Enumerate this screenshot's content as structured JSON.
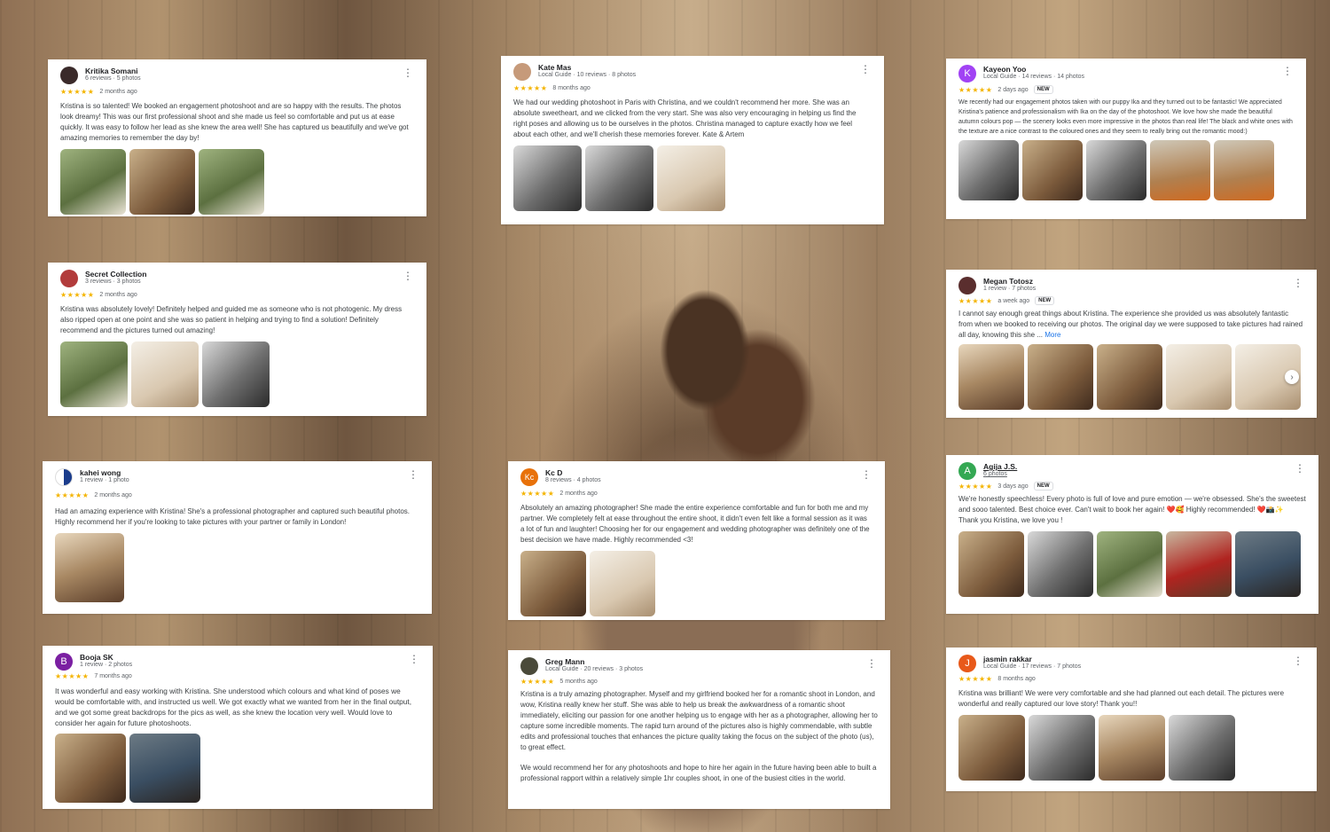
{
  "colors": {
    "star": "#f4b400",
    "link": "#1a73e8"
  },
  "reviews": {
    "kritika": {
      "name": "Kritika Somani",
      "meta": "6 reviews · 5 photos",
      "stars": "★★★★★",
      "ago": "2 months ago",
      "text": "Kristina is so talented! We booked an engagement photoshoot and are so happy with the results. The photos look dreamy! This was our first professional shoot and she made us feel so comfortable and put us at ease quickly. It was easy to follow her lead as she knew the area well! She has captured us beautifully and we've got amazing memories to remember the day by!"
    },
    "kate": {
      "name": "Kate Mas",
      "meta": "Local Guide · 10 reviews · 8 photos",
      "stars": "★★★★★",
      "ago": "8 months ago",
      "text": "We had our wedding photoshoot in Paris with Christina, and we couldn't recommend her more. She was an absolute sweetheart, and we clicked from the very start. She was also very encouraging in helping us find the right poses and allowing us to be ourselves in the photos. Christina managed to capture exactly how we feel about each other, and we'll cherish these memories forever. Kate & Artem"
    },
    "kayeon": {
      "name": "Kayeon Yoo",
      "initial": "K",
      "meta": "Local Guide · 14 reviews · 14 photos",
      "stars": "★★★★★",
      "ago": "2 days ago",
      "badge": "NEW",
      "text": "We recently had our engagement photos taken with our puppy Ika and they turned out to be fantastic! We appreciated Kristina's patience and professionalism with Ika on the day of the photoshoot. We love how she made the beautiful autumn colours pop — the scenery looks even more impressive in the photos than real life! The black and white ones with the texture are a nice contrast to the coloured ones and they seem to really bring out the romantic mood:)"
    },
    "secret": {
      "name": "Secret Collection",
      "meta": "3 reviews · 3 photos",
      "stars": "★★★★★",
      "ago": "2 months ago",
      "text": "Kristina was absolutely lovely! Definitely helped and guided me as someone who is not photogenic. My dress also ripped open at one point and she was so patient in helping and trying to find a solution! Definitely recommend and the pictures turned out amazing!"
    },
    "megan": {
      "name": "Megan Totosz",
      "meta": "1 review · 7 photos",
      "stars": "★★★★★",
      "ago": "a week ago",
      "badge": "NEW",
      "text": "I cannot say enough great things about Kristina. The experience she provided us was absolutely fantastic from when we booked to receiving our photos. The original day we were supposed to take pictures had rained all day, knowing this she ...",
      "more": "More"
    },
    "kahei": {
      "name": "kahei wong",
      "meta": "1 review · 1 photo",
      "stars": "★★★★★",
      "ago": "2 months ago",
      "text": "Had an amazing experience with Kristina! She's a professional photographer and captured such beautiful photos. Highly recommend her if you're looking to take pictures with your partner or family in London!"
    },
    "kcd": {
      "name": "Kc D",
      "initial": "Kc",
      "meta": "8 reviews · 4 photos",
      "stars": "★★★★★",
      "ago": "2 months ago",
      "text": "Absolutely an amazing photographer! She made the entire experience comfortable and fun for both me and my partner. We completely felt at ease throughout the entire shoot, it didn't even felt like a formal session as it was a lot of fun and laughter! Choosing her for our engagement and wedding photographer was definitely one of the best decision we have made. Highly recommended <3!"
    },
    "agija": {
      "name": "Agija J.S.",
      "initial": "A",
      "meta": "6 photos",
      "stars": "★★★★★",
      "ago": "3 days ago",
      "badge": "NEW",
      "text": "We're honestly speechless! Every photo is full of love and pure emotion — we're obsessed. She's the sweetest and sooo talented. Best choice ever. Can't wait to book her again! ❤️🥰 Highly recommended! ❤️📸✨",
      "text2": "Thank you Kristina, we love you !"
    },
    "booja": {
      "name": "Booja SK",
      "initial": "B",
      "meta": "1 review · 2 photos",
      "stars": "★★★★★",
      "ago": "7 months ago",
      "text": "It was wonderful and easy working with Kristina. She understood which colours and what kind of poses we would be comfortable with, and instructed us well. We got exactly what we wanted from her in the final output, and we got some great backdrops for the pics as well, as she knew the location very well. Would love to consider her again for future photoshoots."
    },
    "greg": {
      "name": "Greg Mann",
      "meta": "Local Guide · 20 reviews · 3 photos",
      "stars": "★★★★★",
      "ago": "5 months ago",
      "text": "Kristina is a truly amazing photographer. Myself and my girlfriend booked her for a romantic shoot in London, and wow, Kristina really knew her stuff. She was able to help us break the awkwardness of a romantic shoot immediately, eliciting our passion for one another helping us to engage with her as a photographer, allowing her to capture some incredible moments. The rapid turn around of the pictures also is highly commendable, with subtle edits and professional touches that enhances the picture quality taking the focus on the subject of the photo (us), to great effect.",
      "text2": "We would recommend her for any photoshoots and hope to hire her again in the future having been able to built a professional rapport within a relatively simple 1hr couples shoot, in one of the busiest cities in the world."
    },
    "jasmin": {
      "name": "jasmin rakkar",
      "initial": "J",
      "meta": "Local Guide · 17 reviews · 7 photos",
      "stars": "★★★★★",
      "ago": "8 months ago",
      "text": "Kristina was brilliant! We were very comfortable and she had planned out each detail. The pictures were wonderful and really captured our love story! Thank you!!"
    }
  },
  "icons": {
    "menu": "more-vert-icon",
    "next": "chevron-right-icon"
  }
}
